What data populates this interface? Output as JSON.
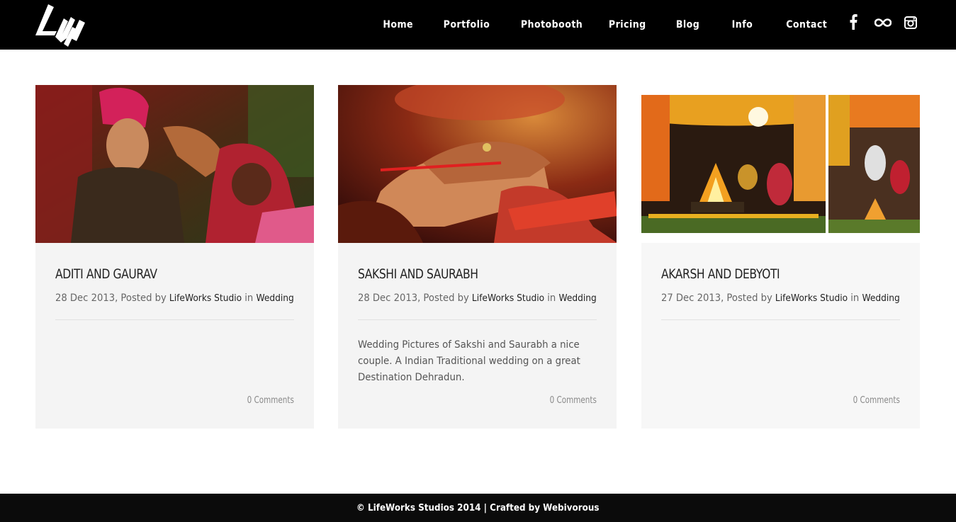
{
  "nav": {
    "items": [
      "Home",
      "Portfolio",
      "Photobooth",
      "Pricing",
      "Blog",
      "Info",
      "Contact"
    ]
  },
  "social": {
    "icons": [
      "facebook-icon",
      "flickr-infinity-icon",
      "instagram-icon"
    ]
  },
  "posts": [
    {
      "title": "ADITI AND GAURAV",
      "date": "28 Dec 2013, Posted by",
      "author": "LifeWorks Studio",
      "in": "in",
      "category": "Wedding",
      "excerpt": "",
      "comments": "0 Comments"
    },
    {
      "title": "SAKSHI AND SAURABH",
      "date": "28 Dec 2013, Posted by",
      "author": "LifeWorks Studio",
      "in": "in",
      "category": "Wedding",
      "excerpt": "Wedding Pictures of Sakshi and Saurabh a nice couple. A Indian Traditional wedding on a great Destination Dehradun.",
      "comments": "0 Comments"
    },
    {
      "title": "AKARSH AND DEBYOTI",
      "date": "27 Dec 2013, Posted by",
      "author": "LifeWorks Studio",
      "in": "in",
      "category": "Wedding",
      "excerpt": "",
      "comments": "0 Comments"
    }
  ],
  "footer": {
    "text": "© LifeWorks Studios 2014 | Crafted by Webivorous"
  },
  "colors": {
    "header_bg": "#000000",
    "card_bg": "#f4f4f4",
    "footer_bg": "#0b0b0b"
  }
}
